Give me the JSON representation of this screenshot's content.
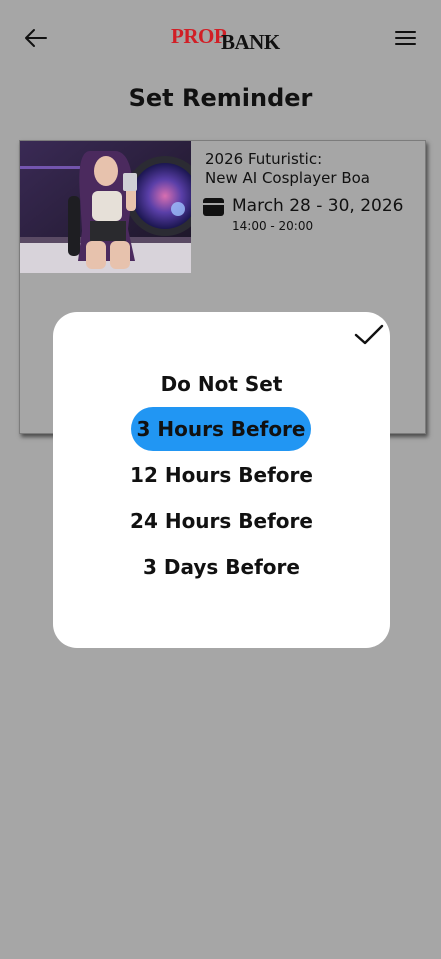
{
  "header": {
    "logo_part1": "PROP",
    "logo_part2": "BANK",
    "back_icon": "arrow-left-icon",
    "menu_icon": "hamburger-menu-icon"
  },
  "page": {
    "title": "Set Reminder"
  },
  "event": {
    "title_line1": "2026 Futuristic:",
    "title_line2": "New AI Cosplayer Boa",
    "date": "March 28 - 30, 2026",
    "time": "14:00 - 20:00",
    "calendar_icon": "calendar-icon"
  },
  "reminder_modal": {
    "confirm_icon": "checkmark-icon",
    "selected_index": 1,
    "options": [
      "Do Not Set",
      "3 Hours Before",
      "12 Hours Before",
      "24 Hours Before",
      "3 Days Before"
    ]
  },
  "colors": {
    "background": "#a6a6a6",
    "accent": "#2196f3",
    "logo_red": "#d11f26",
    "modal_bg": "#ffffff"
  }
}
